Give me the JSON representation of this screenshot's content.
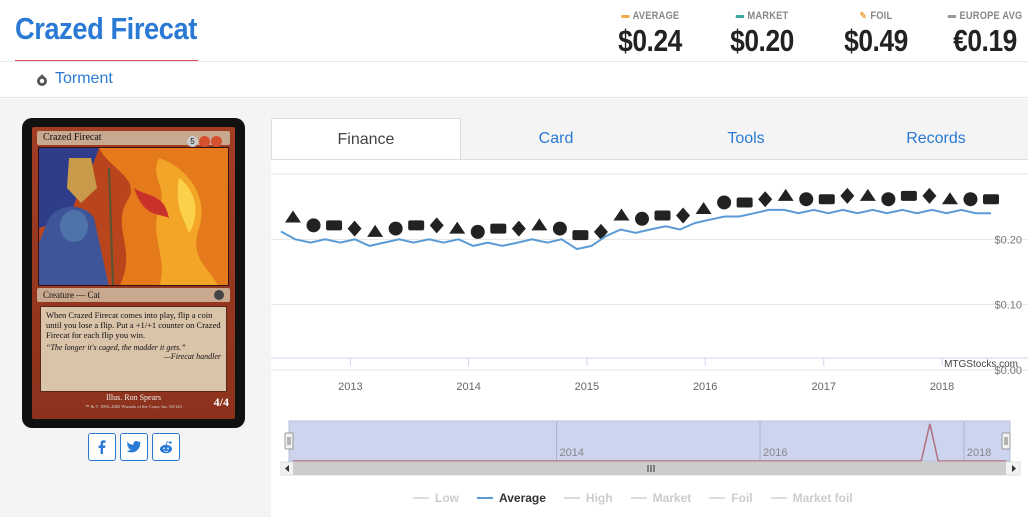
{
  "card": {
    "title": "Crazed Firecat",
    "set_name": "Torment",
    "name_line": "Crazed Firecat",
    "mana_cost": [
      "5",
      "R",
      "R"
    ],
    "type_line": "Creature — Cat",
    "rules_text": "When Crazed Firecat comes into play, flip a coin until you lose a flip. Put a +1/+1 counter on Crazed Firecat for each flip you win.",
    "flavor_text": "“The longer it's caged, the madder it gets.”",
    "flavor_attrib": "—Firecat handler",
    "artist": "Illus. Ron Spears",
    "copyright": "™ & © 1993–2002 Wizards of the Coast, Inc. 94/143",
    "power_toughness": "4/4"
  },
  "prices": [
    {
      "label": "AVERAGE",
      "value": "$0.24",
      "color": "#f0ad4e"
    },
    {
      "label": "MARKET",
      "value": "$0.20",
      "color": "#3aa7a0"
    },
    {
      "label": "FOIL",
      "value": "$0.49",
      "color": "#f0ad4e"
    },
    {
      "label": "EUROPE AVG",
      "value": "€0.19",
      "color": "#999999"
    }
  ],
  "social": [
    {
      "name": "facebook",
      "glyph": "f"
    },
    {
      "name": "twitter",
      "glyph": "t"
    },
    {
      "name": "reddit",
      "glyph": "r"
    }
  ],
  "tabs": [
    {
      "label": "Finance",
      "active": true
    },
    {
      "label": "Card",
      "active": false
    },
    {
      "label": "Tools",
      "active": false
    },
    {
      "label": "Records",
      "active": false
    }
  ],
  "chart_data": {
    "type": "line",
    "x_tick_labels": [
      "2013",
      "2014",
      "2015",
      "2016",
      "2017",
      "2018"
    ],
    "y_tick_labels": [
      "$0.20",
      "$0.10",
      "$0.00"
    ],
    "ylim": [
      0,
      0.3
    ],
    "watermark": "MTGStocks.com",
    "series": [
      {
        "name": "Average",
        "color": "#5b9bd5",
        "points": [
          [
            "2012-06-01",
            0.212
          ],
          [
            "2012-07-15",
            0.2
          ],
          [
            "2012-09-01",
            0.195
          ],
          [
            "2012-10-15",
            0.2
          ],
          [
            "2012-12-01",
            0.195
          ],
          [
            "2013-01-15",
            0.2
          ],
          [
            "2013-03-01",
            0.19
          ],
          [
            "2013-04-15",
            0.195
          ],
          [
            "2013-06-01",
            0.2
          ],
          [
            "2013-07-15",
            0.195
          ],
          [
            "2013-09-01",
            0.2
          ],
          [
            "2013-10-15",
            0.195
          ],
          [
            "2013-12-01",
            0.2
          ],
          [
            "2014-01-15",
            0.19
          ],
          [
            "2014-03-01",
            0.195
          ],
          [
            "2014-04-15",
            0.19
          ],
          [
            "2014-06-01",
            0.195
          ],
          [
            "2014-07-15",
            0.2
          ],
          [
            "2014-09-01",
            0.195
          ],
          [
            "2014-10-15",
            0.2
          ],
          [
            "2014-12-01",
            0.185
          ],
          [
            "2015-01-15",
            0.19
          ],
          [
            "2015-03-01",
            0.205
          ],
          [
            "2015-04-15",
            0.215
          ],
          [
            "2015-06-01",
            0.21
          ],
          [
            "2015-07-15",
            0.215
          ],
          [
            "2015-09-01",
            0.22
          ],
          [
            "2015-10-15",
            0.215
          ],
          [
            "2015-12-01",
            0.225
          ],
          [
            "2016-01-15",
            0.23
          ],
          [
            "2016-03-01",
            0.235
          ],
          [
            "2016-04-15",
            0.235
          ],
          [
            "2016-06-01",
            0.24
          ],
          [
            "2016-07-15",
            0.245
          ],
          [
            "2016-09-01",
            0.245
          ],
          [
            "2016-10-15",
            0.24
          ],
          [
            "2016-12-01",
            0.245
          ],
          [
            "2017-01-15",
            0.24
          ],
          [
            "2017-03-01",
            0.245
          ],
          [
            "2017-04-15",
            0.24
          ],
          [
            "2017-06-01",
            0.245
          ],
          [
            "2017-07-15",
            0.24
          ],
          [
            "2017-09-01",
            0.245
          ],
          [
            "2017-10-15",
            0.24
          ],
          [
            "2017-12-01",
            0.245
          ],
          [
            "2018-01-15",
            0.24
          ],
          [
            "2018-03-01",
            0.245
          ],
          [
            "2018-04-15",
            0.24
          ],
          [
            "2018-06-01",
            0.24
          ]
        ]
      }
    ],
    "navigator_labels": [
      "2014",
      "2016",
      "2018"
    ],
    "navigator_series": {
      "color": "#b07080",
      "points": [
        [
          "2011-06-01",
          0.0
        ],
        [
          "2017-08-01",
          0.0
        ],
        [
          "2017-09-01",
          0.49
        ],
        [
          "2017-10-01",
          0.0
        ],
        [
          "2018-06-01",
          0.0
        ]
      ]
    },
    "legend": [
      {
        "label": "Low",
        "active": false
      },
      {
        "label": "Average",
        "active": true
      },
      {
        "label": "High",
        "active": false
      },
      {
        "label": "Market",
        "active": false
      },
      {
        "label": "Foil",
        "active": false
      },
      {
        "label": "Market foil",
        "active": false
      }
    ]
  }
}
